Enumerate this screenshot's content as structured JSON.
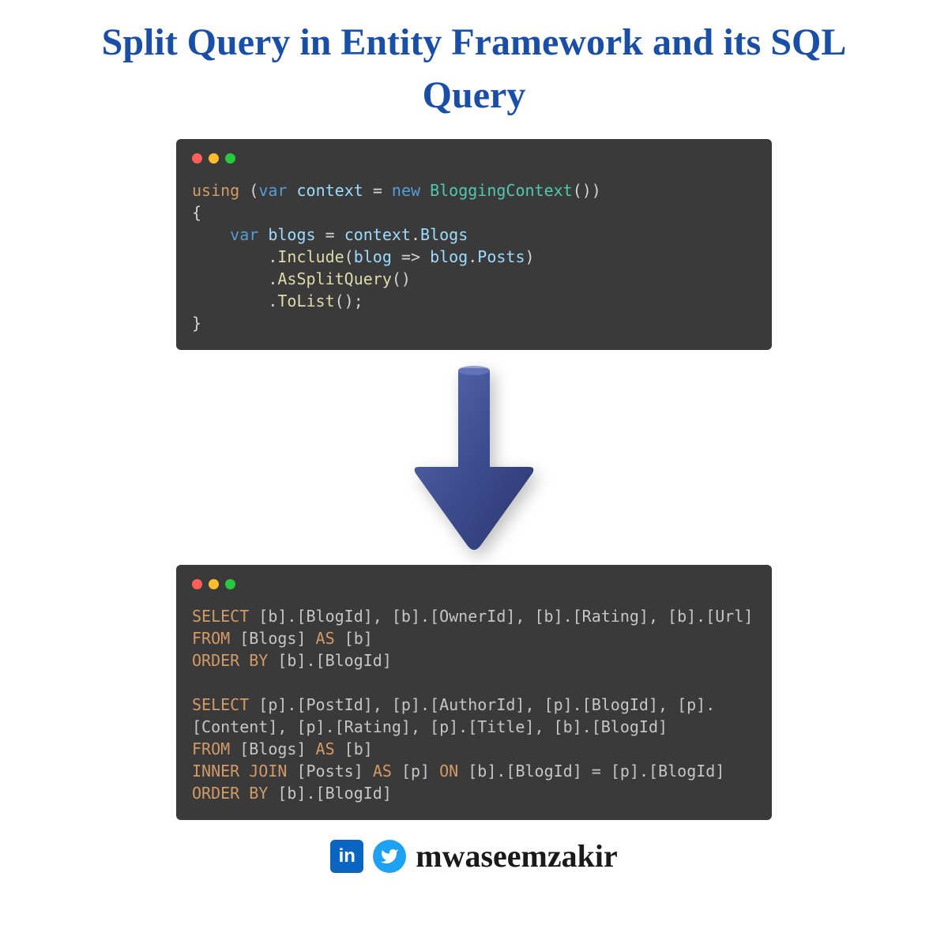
{
  "title": "Split Query in Entity Framework and its SQL Query",
  "code1": {
    "tokens": [
      [
        [
          "kw-orange",
          "using"
        ],
        [
          "kw-white",
          " ("
        ],
        [
          "kw-blue",
          "var"
        ],
        [
          "kw-white",
          " "
        ],
        [
          "kw-light",
          "context"
        ],
        [
          "kw-white",
          " = "
        ],
        [
          "kw-blue",
          "new"
        ],
        [
          "kw-white",
          " "
        ],
        [
          "kw-teal",
          "BloggingContext"
        ],
        [
          "kw-white",
          "())"
        ]
      ],
      [
        [
          "kw-white",
          "{"
        ]
      ],
      [
        [
          "kw-white",
          "    "
        ],
        [
          "kw-blue",
          "var"
        ],
        [
          "kw-white",
          " "
        ],
        [
          "kw-light",
          "blogs"
        ],
        [
          "kw-white",
          " = "
        ],
        [
          "kw-light",
          "context"
        ],
        [
          "kw-white",
          "."
        ],
        [
          "kw-light",
          "Blogs"
        ]
      ],
      [
        [
          "kw-white",
          "        ."
        ],
        [
          "kw-method",
          "Include"
        ],
        [
          "kw-white",
          "("
        ],
        [
          "kw-light",
          "blog"
        ],
        [
          "kw-white",
          " => "
        ],
        [
          "kw-light",
          "blog"
        ],
        [
          "kw-white",
          "."
        ],
        [
          "kw-light",
          "Posts"
        ],
        [
          "kw-white",
          ")"
        ]
      ],
      [
        [
          "kw-white",
          "        ."
        ],
        [
          "kw-method",
          "AsSplitQuery"
        ],
        [
          "kw-white",
          "()"
        ]
      ],
      [
        [
          "kw-white",
          "        ."
        ],
        [
          "kw-method",
          "ToList"
        ],
        [
          "kw-white",
          "();"
        ]
      ],
      [
        [
          "kw-white",
          "}"
        ]
      ]
    ]
  },
  "code2": {
    "tokens": [
      [
        [
          "sql-orange",
          "SELECT"
        ],
        [
          "kw-gray",
          " [b].[BlogId], [b].[OwnerId], [b].[Rating], [b].[Url]"
        ]
      ],
      [
        [
          "sql-orange",
          "FROM"
        ],
        [
          "kw-gray",
          " [Blogs] "
        ],
        [
          "sql-orange",
          "AS"
        ],
        [
          "kw-gray",
          " [b]"
        ]
      ],
      [
        [
          "sql-orange",
          "ORDER BY"
        ],
        [
          "kw-gray",
          " [b].[BlogId]"
        ]
      ],
      [
        [
          "kw-gray",
          " "
        ]
      ],
      [
        [
          "sql-orange",
          "SELECT"
        ],
        [
          "kw-gray",
          " [p].[PostId], [p].[AuthorId], [p].[BlogId], [p]."
        ]
      ],
      [
        [
          "kw-gray",
          "[Content], [p].[Rating], [p].[Title], [b].[BlogId]"
        ]
      ],
      [
        [
          "sql-orange",
          "FROM"
        ],
        [
          "kw-gray",
          " [Blogs] "
        ],
        [
          "sql-orange",
          "AS"
        ],
        [
          "kw-gray",
          " [b]"
        ]
      ],
      [
        [
          "sql-orange",
          "INNER"
        ],
        [
          "kw-gray",
          " "
        ],
        [
          "sql-orange",
          "JOIN"
        ],
        [
          "kw-gray",
          " [Posts] "
        ],
        [
          "sql-orange",
          "AS"
        ],
        [
          "kw-gray",
          " [p] "
        ],
        [
          "sql-orange",
          "ON"
        ],
        [
          "kw-gray",
          " [b].[BlogId] = [p].[BlogId]"
        ]
      ],
      [
        [
          "sql-orange",
          "ORDER BY"
        ],
        [
          "kw-gray",
          " [b].[BlogId]"
        ]
      ]
    ]
  },
  "footer": {
    "linkedin_label": "in",
    "handle": "mwaseemzakir"
  },
  "colors": {
    "title": "#1a4fa8",
    "arrow": "#3d4d8f"
  }
}
